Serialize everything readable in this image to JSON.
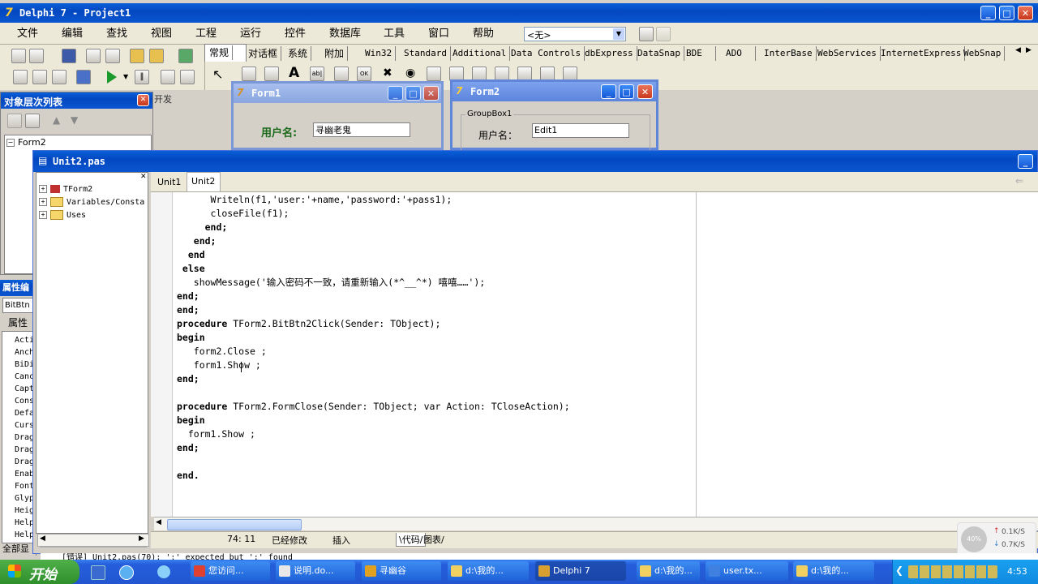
{
  "app": {
    "title": "Delphi 7 - Project1"
  },
  "menu": [
    "文件",
    "编辑",
    "查找",
    "视图",
    "工程",
    "运行",
    "控件",
    "数据库",
    "工具",
    "窗口",
    "帮助"
  ],
  "combo": {
    "value": "<无>"
  },
  "palette_tabs": [
    "常规",
    "对话框",
    "系统",
    "附加",
    "Win32",
    "Standard",
    "Additional",
    "Data Controls",
    "dbExpress",
    "DataSnap",
    "BDE",
    "ADO",
    "InterBase",
    "WebServices",
    "InternetExpress",
    "WebSnap"
  ],
  "object_tree": {
    "title": "对象层次列表",
    "root": "Form2"
  },
  "property_panel": {
    "title": "属性编",
    "object": "BitBtn",
    "tab": "属性",
    "items": [
      "Acti",
      "Anch",
      "BiDi",
      "Canc",
      "Capt",
      "Cons",
      "Defa",
      "Curs",
      "Drag",
      "Drag",
      "Drag",
      "Enab",
      "Font",
      "Glyp",
      "Heig",
      "Help",
      "Help"
    ],
    "footer": "全部显"
  },
  "bg_text": "开发",
  "form1": {
    "title": "Form1",
    "label": "用户名:",
    "edit": "寻幽老鬼"
  },
  "form2": {
    "title": "Form2",
    "group": "GroupBox1",
    "label": "用户名：",
    "edit": "Edit1"
  },
  "editor": {
    "title": "Unit2.pas",
    "tabs": [
      "Unit1",
      "Unit2"
    ],
    "tree": [
      "TForm2",
      "Variables/Consta",
      "Uses"
    ],
    "code": [
      {
        "t": "      Writeln(f1,'user:'+name,'password:'+pass1);",
        "b": false
      },
      {
        "t": "      closeFile(f1);",
        "b": false
      },
      {
        "t": "     end;",
        "b": true
      },
      {
        "t": "   end;",
        "b": true
      },
      {
        "t": "  end",
        "b": true
      },
      {
        "t": " else",
        "b": true
      },
      {
        "t": "   showMessage('输入密码不一致，请重新输入(*^__^*) 嘻嘻……');",
        "b": false
      },
      {
        "t": "end;",
        "b": true
      },
      {
        "t": "end;",
        "b": true
      },
      {
        "t": "procedure TForm2.BitBtn2Click(Sender: TObject);",
        "b": false,
        "kw": "procedure"
      },
      {
        "t": "begin",
        "b": true
      },
      {
        "t": "   form2.Close ;",
        "b": false
      },
      {
        "t": "   form1.Show ;",
        "b": false
      },
      {
        "t": "end;",
        "b": true
      },
      {
        "t": "",
        "b": false
      },
      {
        "t": "procedure TForm2.FormClose(Sender: TObject; var Action: TCloseAction);",
        "b": false,
        "kw": "procedure"
      },
      {
        "t": "begin",
        "b": true
      },
      {
        "t": "  form1.Show ;",
        "b": false
      },
      {
        "t": "end;",
        "b": true
      },
      {
        "t": "",
        "b": false
      },
      {
        "t": "end.",
        "b": true
      }
    ],
    "status": {
      "pos": "74: 11",
      "modified": "已经修改",
      "mode": "插入",
      "tab_code": "代码",
      "tab_diagram": "图表"
    }
  },
  "error_line": "[错误] Unit2.pas(70): ';' expected but ':' found",
  "taskbar": {
    "start": "开始",
    "tasks": [
      "您访问...",
      "说明.do...",
      "寻幽谷",
      "d:\\我的...",
      "Delphi 7",
      "d:\\我的...",
      "user.tx...",
      "d:\\我的..."
    ],
    "time": "4:53",
    "net_up": "0.1K/S",
    "net_down": "0.7K/S",
    "net_pct": "40%"
  }
}
